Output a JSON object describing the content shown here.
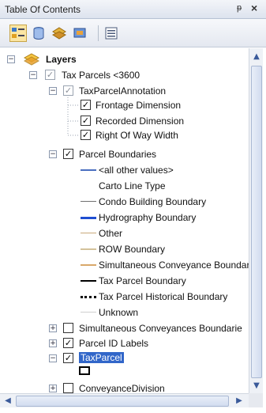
{
  "window": {
    "title": "Table Of Contents",
    "pin_glyph": "ᵽ",
    "close_glyph": "×"
  },
  "toolbar": {
    "buttons": [
      {
        "name": "list-by-drawing-order-icon",
        "active": true
      },
      {
        "name": "list-by-source-icon",
        "active": false
      },
      {
        "name": "list-by-visibility-icon",
        "active": false
      },
      {
        "name": "list-by-selection-icon",
        "active": false
      },
      {
        "name": "options-icon",
        "active": false
      }
    ]
  },
  "tree": {
    "layers_label": "Layers",
    "tax_parcels_label": "Tax Parcels <3600",
    "annotation_label": "TaxParcelAnnotation",
    "annotation_classes": [
      "Frontage Dimension",
      "Recorded Dimension",
      "Right Of Way Width"
    ],
    "parcel_boundaries_label": "Parcel Boundaries",
    "legend": [
      {
        "label": "<all other values>",
        "color": "#4a6fc0",
        "style": "solid",
        "width": 2
      },
      {
        "label": "Carto Line Type",
        "color": "",
        "style": "none",
        "width": 0
      },
      {
        "label": "Condo Building Boundary",
        "color": "#6f6f6f",
        "style": "solid",
        "width": 1
      },
      {
        "label": "Hydrography Boundary",
        "color": "#1f4fd1",
        "style": "solid",
        "width": 3
      },
      {
        "label": "Other",
        "color": "#c9a97a",
        "style": "solid",
        "width": 1
      },
      {
        "label": "ROW Boundary",
        "color": "#d3c29b",
        "style": "solid",
        "width": 2
      },
      {
        "label": "Simultaneous Conveyance Boundar",
        "color": "#d8a86a",
        "style": "solid",
        "width": 2
      },
      {
        "label": "Tax Parcel Boundary",
        "color": "#000000",
        "style": "solid",
        "width": 2
      },
      {
        "label": "Tax Parcel Historical Boundary",
        "color": "#000000",
        "style": "dotted",
        "width": 3
      },
      {
        "label": "Unknown",
        "color": "#d0d0d0",
        "style": "solid",
        "width": 1
      }
    ],
    "sim_conveyances_label": "Simultaneous Conveyances Boundarie",
    "parcel_id_labels_label": "Parcel ID Labels",
    "taxparcel_label": "TaxParcel",
    "conveyance_division_label": "ConveyanceDivision"
  },
  "glyphs": {
    "expand_minus": "−",
    "expand_plus": "+",
    "check": "✓",
    "scroll_up": "▲",
    "scroll_down": "▼",
    "scroll_left": "◀",
    "scroll_right": "▶"
  }
}
